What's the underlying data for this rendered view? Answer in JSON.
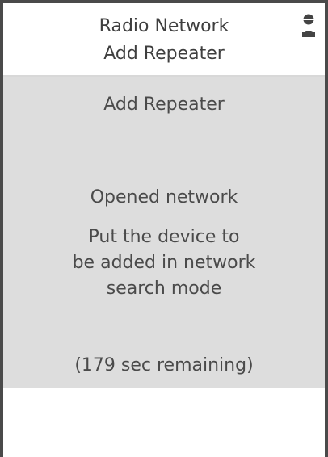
{
  "header": {
    "line1": "Radio Network",
    "line2": "Add Repeater",
    "icon": "user-icon"
  },
  "panel": {
    "title": "Add Repeater",
    "status": "Opened network",
    "instruction": "Put the device to\nbe added in network\nsearch mode",
    "remaining": "(179 sec remaining)"
  }
}
